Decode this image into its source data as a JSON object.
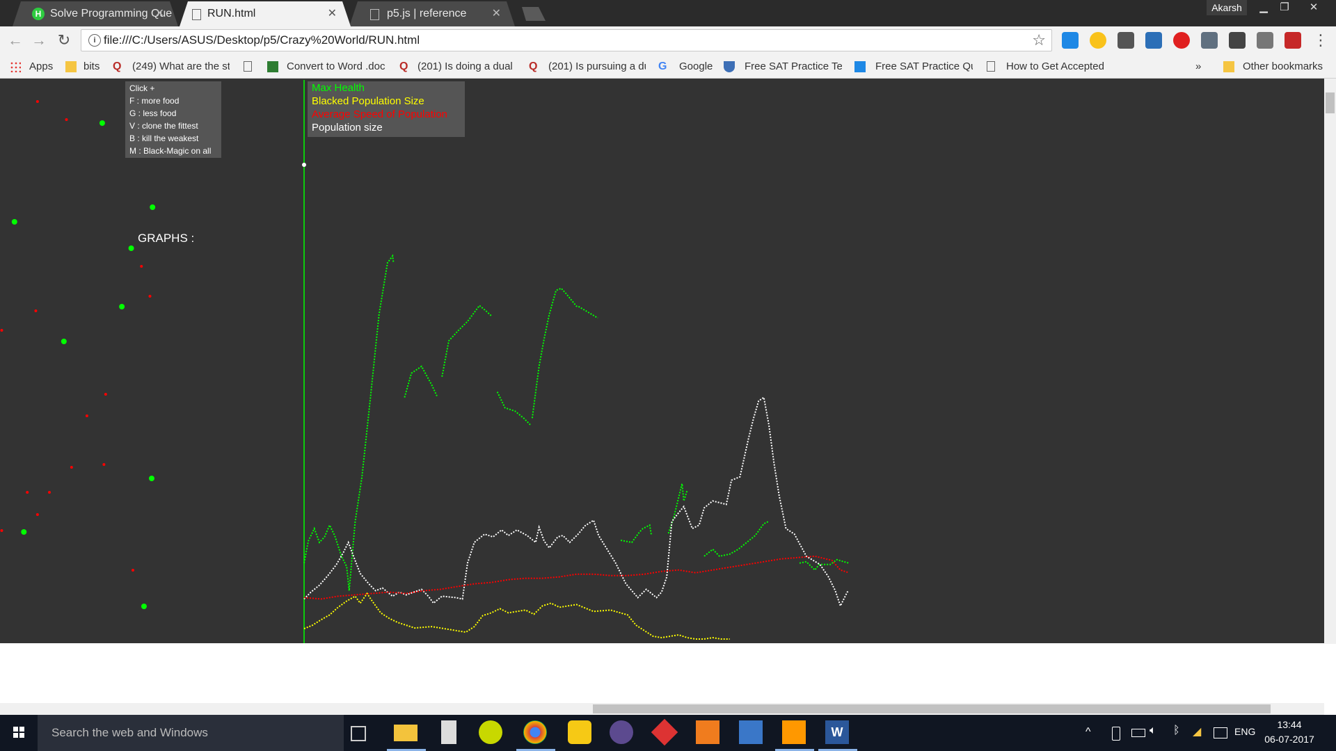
{
  "browser": {
    "profile": "Akarsh",
    "tabs": [
      {
        "title": "Solve Programming Que",
        "active": false
      },
      {
        "title": "RUN.html",
        "active": true
      },
      {
        "title": "p5.js | reference",
        "active": false
      }
    ],
    "url": "file:///C:/Users/ASUS/Desktop/p5/Crazy%20World/RUN.html",
    "bookmarks": [
      "Apps",
      "bits",
      "(249) What are the st",
      "Convert to Word .doc",
      "(201) Is doing a dual",
      "(201) Is pursuing a du",
      "Google",
      "Free SAT Practice Tes",
      "Free SAT Practice Qu",
      "How to Get Accepted"
    ],
    "bookmarks_more": "»",
    "other_bookmarks": "Other bookmarks"
  },
  "canvas": {
    "help_lines": [
      "Click +",
      "F : more food",
      "G : less food",
      "V : clone the fittest",
      "B : kill the weakest",
      "M : Black-Magic on all"
    ],
    "graphs_label": "GRAPHS :",
    "legend": [
      {
        "label": "Max Health",
        "color": "#00ff00"
      },
      {
        "label": "Blacked Population Size",
        "color": "#ffff00"
      },
      {
        "label": "Average Speed of Population",
        "color": "#ff0000"
      },
      {
        "label": "Population size",
        "color": "#ffffff"
      }
    ]
  },
  "chart_data": {
    "type": "line",
    "title": "",
    "xlabel": "",
    "ylabel": "",
    "grid": false,
    "legend_position": "top-left",
    "series": [
      {
        "name": "Max Health",
        "color": "#00ff00",
        "points": [
          [
            0,
            110
          ],
          [
            5,
            142
          ],
          [
            12,
            160
          ],
          [
            18,
            140
          ],
          [
            24,
            148
          ],
          [
            30,
            165
          ],
          [
            36,
            150
          ],
          [
            44,
            120
          ],
          [
            50,
            105
          ],
          [
            53,
            70
          ],
          [
            60,
            170
          ],
          [
            68,
            235
          ],
          [
            78,
            350
          ],
          [
            88,
            470
          ],
          [
            98,
            545
          ],
          [
            104,
            555
          ],
          [
            105,
            545
          ],
          null,
          [
            118,
            350
          ],
          [
            126,
            385
          ],
          [
            138,
            395
          ],
          [
            150,
            368
          ],
          [
            156,
            352
          ],
          null,
          [
            162,
            380
          ],
          [
            170,
            432
          ],
          [
            182,
            448
          ],
          [
            192,
            460
          ],
          [
            206,
            483
          ],
          [
            213,
            476
          ],
          [
            220,
            468
          ],
          null,
          [
            227,
            358
          ],
          [
            236,
            335
          ],
          [
            248,
            330
          ],
          [
            258,
            320
          ],
          [
            266,
            310
          ],
          null,
          [
            268,
            320
          ],
          [
            276,
            395
          ],
          [
            282,
            435
          ],
          [
            288,
            470
          ],
          [
            296,
            505
          ],
          [
            302,
            508
          ],
          [
            308,
            500
          ],
          [
            320,
            482
          ],
          [
            322,
            482
          ],
          [
            345,
            465
          ],
          null,
          [
            372,
            143
          ],
          [
            385,
            140
          ],
          [
            394,
            155
          ],
          [
            398,
            160
          ],
          [
            406,
            165
          ],
          [
            408,
            150
          ],
          null,
          [
            428,
            153
          ],
          [
            434,
            175
          ],
          [
            440,
            205
          ],
          [
            444,
            225
          ],
          [
            446,
            200
          ],
          [
            450,
            215
          ],
          null,
          [
            470,
            120
          ],
          [
            480,
            130
          ],
          [
            488,
            120
          ],
          [
            500,
            123
          ],
          [
            510,
            130
          ],
          [
            520,
            140
          ],
          [
            530,
            150
          ],
          [
            540,
            167
          ],
          [
            545,
            170
          ],
          null,
          [
            582,
            110
          ],
          [
            590,
            112
          ],
          [
            600,
            100
          ],
          [
            605,
            108
          ],
          [
            618,
            108
          ],
          [
            626,
            115
          ],
          [
            634,
            112
          ],
          [
            640,
            110
          ]
        ]
      },
      {
        "name": "Population size",
        "color": "#ffffff",
        "points": [
          [
            0,
            58
          ],
          [
            8,
            68
          ],
          [
            18,
            78
          ],
          [
            28,
            92
          ],
          [
            38,
            108
          ],
          [
            46,
            125
          ],
          [
            52,
            140
          ],
          [
            58,
            120
          ],
          [
            66,
            95
          ],
          [
            76,
            80
          ],
          [
            84,
            70
          ],
          [
            92,
            74
          ],
          [
            104,
            62
          ],
          [
            112,
            68
          ],
          [
            120,
            64
          ],
          [
            138,
            72
          ],
          [
            146,
            62
          ],
          [
            152,
            52
          ],
          [
            162,
            62
          ],
          [
            178,
            60
          ],
          [
            186,
            58
          ],
          [
            192,
            110
          ],
          [
            200,
            140
          ],
          [
            212,
            152
          ],
          [
            222,
            148
          ],
          [
            232,
            158
          ],
          [
            240,
            150
          ],
          [
            250,
            158
          ],
          [
            262,
            150
          ],
          [
            272,
            140
          ],
          [
            276,
            162
          ],
          [
            282,
            142
          ],
          [
            288,
            132
          ],
          [
            298,
            148
          ],
          [
            304,
            150
          ],
          [
            312,
            140
          ],
          [
            322,
            152
          ],
          [
            330,
            164
          ],
          [
            340,
            172
          ],
          [
            346,
            150
          ],
          [
            356,
            130
          ],
          [
            366,
            110
          ],
          [
            378,
            80
          ],
          [
            392,
            60
          ],
          [
            402,
            72
          ],
          [
            414,
            60
          ],
          [
            420,
            68
          ],
          [
            426,
            90
          ],
          [
            432,
            170
          ],
          [
            438,
            180
          ],
          [
            446,
            192
          ],
          [
            456,
            160
          ],
          [
            464,
            165
          ],
          [
            470,
            190
          ],
          [
            480,
            200
          ],
          [
            496,
            195
          ],
          [
            502,
            230
          ],
          [
            512,
            235
          ],
          [
            522,
            290
          ],
          [
            528,
            320
          ],
          [
            534,
            345
          ],
          [
            540,
            350
          ],
          [
            546,
            310
          ],
          [
            552,
            255
          ],
          [
            558,
            208
          ],
          [
            566,
            160
          ],
          [
            576,
            152
          ],
          [
            590,
            120
          ],
          [
            598,
            114
          ],
          [
            606,
            108
          ],
          [
            616,
            90
          ],
          [
            624,
            70
          ],
          [
            630,
            48
          ],
          [
            638,
            68
          ],
          [
            640,
            70
          ]
        ]
      },
      {
        "name": "Average Speed of Population",
        "color": "#ff0000",
        "points": [
          [
            0,
            60
          ],
          [
            20,
            58
          ],
          [
            40,
            62
          ],
          [
            60,
            64
          ],
          [
            80,
            66
          ],
          [
            100,
            68
          ],
          [
            120,
            66
          ],
          [
            140,
            70
          ],
          [
            160,
            72
          ],
          [
            180,
            76
          ],
          [
            200,
            80
          ],
          [
            220,
            82
          ],
          [
            240,
            86
          ],
          [
            260,
            88
          ],
          [
            280,
            88
          ],
          [
            300,
            90
          ],
          [
            320,
            94
          ],
          [
            340,
            94
          ],
          [
            360,
            92
          ],
          [
            380,
            92
          ],
          [
            400,
            94
          ],
          [
            420,
            98
          ],
          [
            440,
            100
          ],
          [
            460,
            96
          ],
          [
            480,
            100
          ],
          [
            500,
            104
          ],
          [
            520,
            108
          ],
          [
            540,
            112
          ],
          [
            560,
            116
          ],
          [
            580,
            118
          ],
          [
            600,
            120
          ],
          [
            620,
            114
          ],
          [
            630,
            100
          ],
          [
            640,
            96
          ]
        ]
      },
      {
        "name": "Blacked Population Size",
        "color": "#ffff00",
        "points": [
          [
            0,
            15
          ],
          [
            10,
            20
          ],
          [
            20,
            28
          ],
          [
            30,
            35
          ],
          [
            40,
            46
          ],
          [
            50,
            55
          ],
          [
            60,
            62
          ],
          [
            66,
            52
          ],
          [
            74,
            66
          ],
          [
            80,
            55
          ],
          [
            90,
            38
          ],
          [
            100,
            30
          ],
          [
            110,
            24
          ],
          [
            120,
            20
          ],
          [
            130,
            16
          ],
          [
            150,
            18
          ],
          [
            170,
            14
          ],
          [
            190,
            10
          ],
          [
            200,
            18
          ],
          [
            210,
            34
          ],
          [
            220,
            38
          ],
          [
            230,
            44
          ],
          [
            240,
            38
          ],
          [
            250,
            40
          ],
          [
            260,
            42
          ],
          [
            270,
            36
          ],
          [
            280,
            48
          ],
          [
            290,
            52
          ],
          [
            300,
            46
          ],
          [
            320,
            50
          ],
          [
            340,
            40
          ],
          [
            360,
            42
          ],
          [
            380,
            35
          ],
          [
            390,
            20
          ],
          [
            400,
            12
          ],
          [
            410,
            4
          ],
          [
            420,
            2
          ],
          [
            430,
            4
          ],
          [
            440,
            6
          ],
          [
            450,
            2
          ],
          [
            460,
            0
          ],
          [
            470,
            0
          ],
          [
            480,
            2
          ],
          [
            490,
            0
          ],
          [
            500,
            0
          ]
        ]
      }
    ]
  },
  "food_dots": {
    "green": [
      [
        120,
        177
      ],
      [
        160,
        181
      ],
      [
        179,
        298
      ],
      [
        17,
        319
      ],
      [
        154,
        357
      ],
      [
        143,
        441
      ],
      [
        75,
        491
      ],
      [
        178,
        688
      ],
      [
        28,
        765
      ],
      [
        169,
        872
      ]
    ],
    "red": [
      [
        44,
        146
      ],
      [
        78,
        172
      ],
      [
        166,
        383
      ],
      [
        176,
        426
      ],
      [
        42,
        447
      ],
      [
        2,
        475
      ],
      [
        124,
        567
      ],
      [
        102,
        598
      ],
      [
        84,
        672
      ],
      [
        122,
        668
      ],
      [
        32,
        708
      ],
      [
        58,
        708
      ],
      [
        44,
        740
      ],
      [
        2,
        763
      ],
      [
        156,
        820
      ]
    ]
  },
  "taskbar": {
    "search_placeholder": "Search the web and Windows",
    "language": "ENG",
    "time": "13:44",
    "date": "06-07-2017"
  }
}
